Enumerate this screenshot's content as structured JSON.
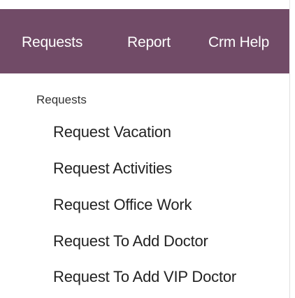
{
  "navbar": {
    "background": "#714b67",
    "items": [
      {
        "label": "Requests"
      },
      {
        "label": "Report"
      },
      {
        "label": "Crm Help"
      }
    ]
  },
  "dropdown": {
    "section_header": "Requests",
    "items": [
      {
        "label": "Request Vacation"
      },
      {
        "label": "Request Activities"
      },
      {
        "label": "Request Office Work"
      },
      {
        "label": "Request To Add Doctor"
      },
      {
        "label": "Request To Add VIP Doctor"
      }
    ]
  }
}
